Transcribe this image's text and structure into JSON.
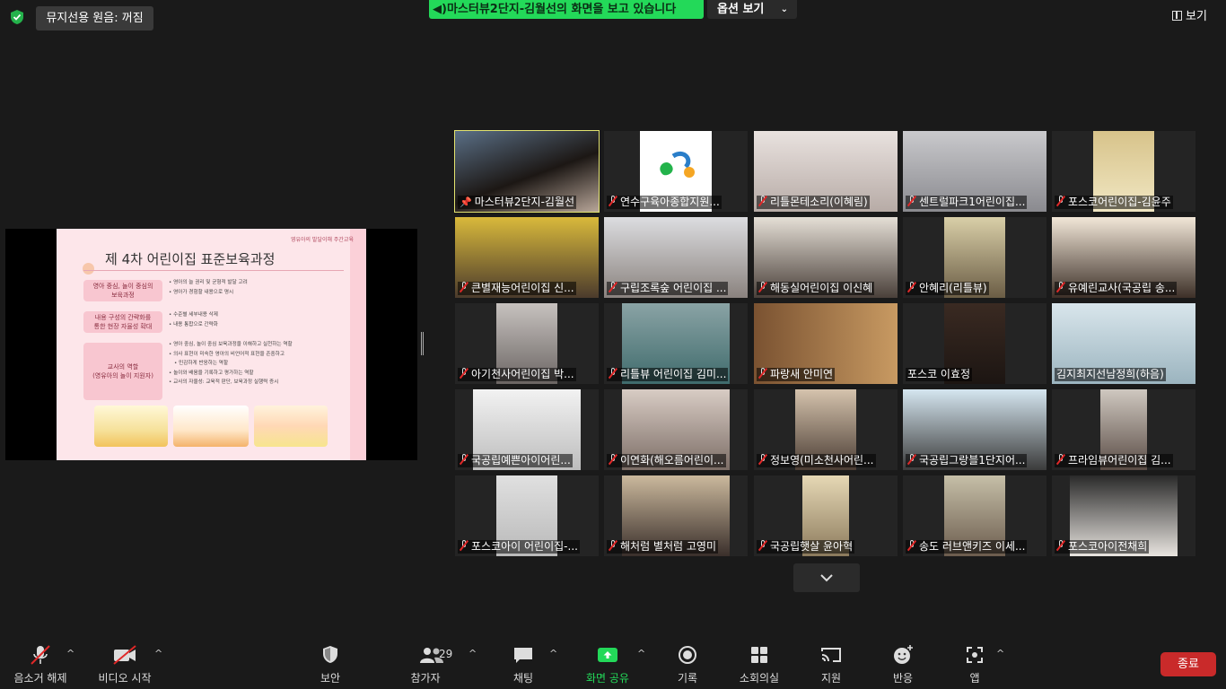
{
  "top": {
    "noise_label": "뮤지선용 원음: 꺼짐",
    "share_banner": "◀)마스터뷰2단지-김월선의 화면을 보고 있습니다",
    "options_label": "옵션 보기",
    "view_label": "보기"
  },
  "slide": {
    "header": "영유아의 발달이해 주간교육",
    "title": "제 4차 어린이집 표준보육과정",
    "blocks": [
      {
        "box": "영아 중심, 놀이 중심의\n보육과정",
        "bullets": [
          "영아의 늘 권리 및 균형적 발달 고려",
          "영아가 경험할 내용으로 명시"
        ]
      },
      {
        "box": "내용 구성의 간략화를\n통한 현장 자율성 확대",
        "bullets": [
          "수준별 세부내용 삭제",
          "내용 통합으로 간략화"
        ]
      },
      {
        "box": "교사의 역할\n(영유아의 놀이 지원자)",
        "bullets": [
          "영아 중심, 놀이 중심 보육과정을 이해하고 실천하는 역할",
          "의사 표현이 미숙한 영아의 비언어적 표현을 존중하고",
          "민감하게 반응하는 역할",
          "놀이와 배움을 기록하고 평가하는 역할",
          "교사의 자율성: 교육적 판단, 보육과정 실행력 증시"
        ]
      }
    ]
  },
  "participants": [
    {
      "name": "마스터뷰2단지-김월선",
      "muted": false,
      "pinned": true,
      "active": true
    },
    {
      "name": "연수구육아종합지원...",
      "muted": true
    },
    {
      "name": "리틀몬테소리(이혜림)",
      "muted": true
    },
    {
      "name": "센트럴파크1어린이집...",
      "muted": true
    },
    {
      "name": "포스코어린이집-김윤주",
      "muted": true
    },
    {
      "name": "큰별재능어린이집 신...",
      "muted": true
    },
    {
      "name": "구립조록숲 어린이집 ...",
      "muted": true
    },
    {
      "name": "해동실어린이집 이신혜",
      "muted": true
    },
    {
      "name": "안혜리(리틀뷰)",
      "muted": true
    },
    {
      "name": "유예린교사(국공립 송...",
      "muted": true
    },
    {
      "name": "아기천사어린이집 박...",
      "muted": true
    },
    {
      "name": "리틀뷰 어린이집 김미...",
      "muted": true
    },
    {
      "name": "파랑새 안미연",
      "muted": true
    },
    {
      "name": "포스코 이효정",
      "muted": false
    },
    {
      "name": "김지최지선남정희(하음)",
      "muted": false
    },
    {
      "name": "국공립예쁜아이어린...",
      "muted": true
    },
    {
      "name": "이연화(해오름어린이...",
      "muted": true
    },
    {
      "name": "정보영(미소천사어린...",
      "muted": true
    },
    {
      "name": "국공립그랑블1단지어...",
      "muted": true
    },
    {
      "name": "프라임뷰어린이집 김...",
      "muted": true
    },
    {
      "name": "포스코아이 어린이집-...",
      "muted": true
    },
    {
      "name": "해처럼 별처럼 고영미",
      "muted": true
    },
    {
      "name": "국공립햇살 윤아혁",
      "muted": true
    },
    {
      "name": "송도 러브앤키즈 이세...",
      "muted": true
    },
    {
      "name": "포스코아이전채희",
      "muted": true
    }
  ],
  "toolbar": {
    "unmute": "음소거 해제",
    "start_video": "비디오 시작",
    "security": "보안",
    "participants": "참가자",
    "participant_count": "29",
    "chat": "채팅",
    "share_screen": "화면 공유",
    "record": "기록",
    "breakout": "소회의실",
    "support": "지원",
    "reactions": "반응",
    "apps": "앱",
    "end": "종료"
  },
  "colors": {
    "accent_green": "#23d959",
    "active_speaker": "#e3e36f",
    "end_red": "#c92a2a",
    "mute_red": "#e02828"
  }
}
